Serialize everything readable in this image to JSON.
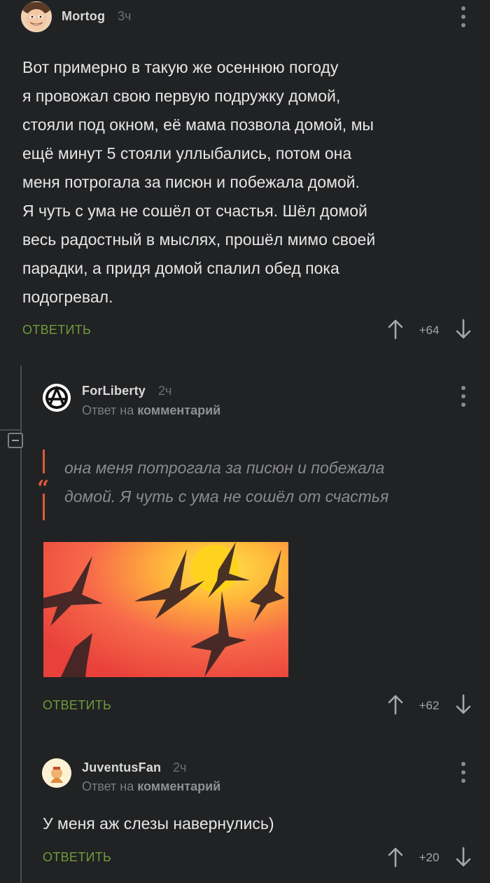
{
  "comments": [
    {
      "username": "Mortog",
      "time": "3ч",
      "text_lines": [
        "Вот примерно в такую же осеннюю погоду",
        "я провожал свою первую подружку домой,",
        "стояли под окном, её мама позвола домой, мы",
        "ещё минут 5 стояли уллыбались, потом она",
        "меня потрогала за писюн и побежала домой.",
        "Я чуть с ума не сошёл от счастья. Шёл домой",
        "весь радостный в мыслях, прошёл мимо своей",
        "парадки, а придя домой спалил обед пока",
        "подогревал."
      ],
      "reply_label": "ОТВЕТИТЬ",
      "score": "+64"
    },
    {
      "username": "ForLiberty",
      "time": "2ч",
      "reply_prefix": "Ответ на",
      "reply_target": "комментарий",
      "quote_lines": [
        "она меня потрогала за писюн и побежала",
        "домой. Я чуть с ума не сошёл от счастья"
      ],
      "image_icon": "flying-cranes-sunset-image",
      "reply_label": "ОТВЕТИТЬ",
      "score": "+62"
    },
    {
      "username": "JuventusFan",
      "time": "2ч",
      "reply_prefix": "Ответ на",
      "reply_target": "комментарий",
      "text": "У меня аж слезы навернулись)",
      "reply_label": "ОТВЕТИТЬ",
      "score": "+20"
    }
  ],
  "colors": {
    "background": "#212224",
    "reply_green": "#6f9a3c",
    "quote_accent": "#e05a3b"
  }
}
